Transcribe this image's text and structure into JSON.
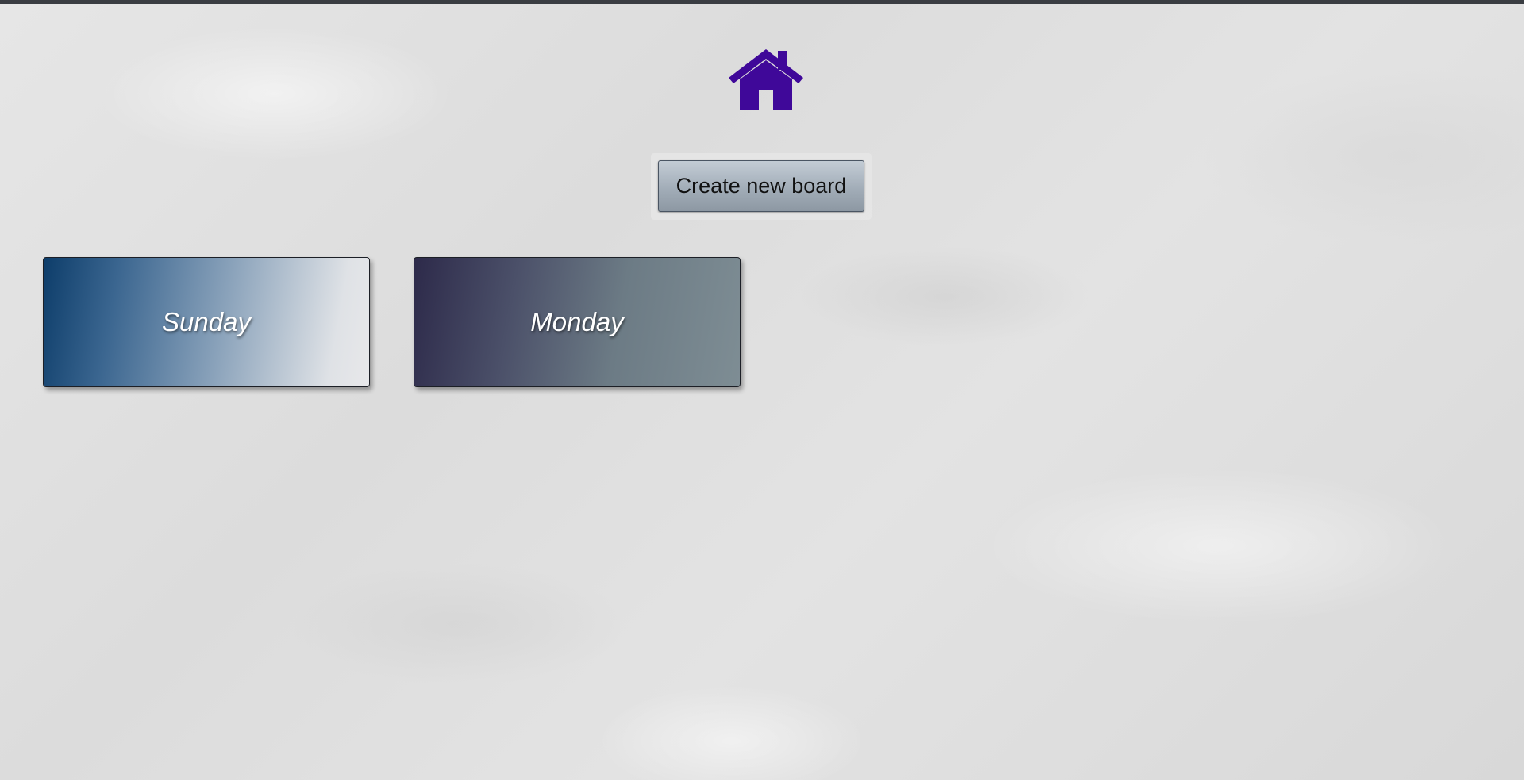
{
  "header": {
    "home_icon": "home-icon",
    "home_color": "#3f0899"
  },
  "toolbar": {
    "create_board_label": "Create new board"
  },
  "boards": [
    {
      "title": "Sunday"
    },
    {
      "title": "Monday"
    }
  ]
}
